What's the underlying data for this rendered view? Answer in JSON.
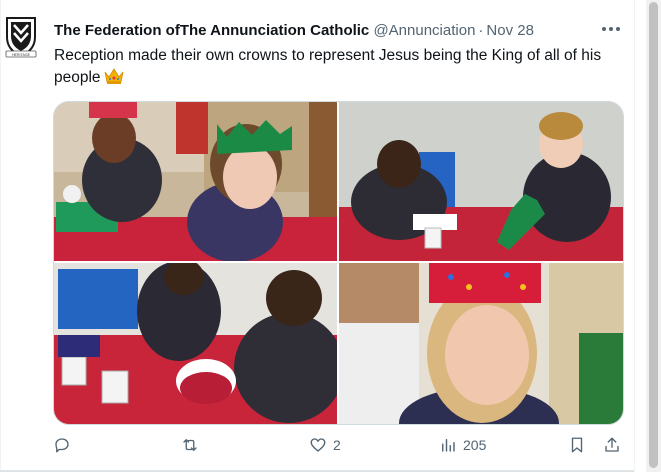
{
  "tweet": {
    "author_name": "The Federation ofThe Annunciation Catholic",
    "handle": "@Annunciation",
    "separator": "·",
    "date": "Nov 28",
    "text": "Reception made their own crowns to represent Jesus being the King of all of his people",
    "emoji": "crown-emoji",
    "avatar_text": "HERITAGE"
  },
  "media": {
    "photos": [
      {
        "description_icon": "photo-children-crowns-table"
      },
      {
        "description_icon": "photo-children-making-crowns"
      },
      {
        "description_icon": "photo-children-decorating-crown"
      },
      {
        "description_icon": "photo-girl-wearing-crown"
      }
    ]
  },
  "actions": {
    "reply_count": "",
    "retweet_count": "",
    "like_count": "2",
    "view_count": "205",
    "icons": [
      "reply-icon",
      "retweet-icon",
      "like-icon",
      "views-icon",
      "bookmark-icon",
      "share-icon"
    ]
  },
  "colors": {
    "text_primary": "#0f1419",
    "text_secondary": "#536471",
    "border": "#cfd9de",
    "crown_gold": "#f5b301"
  }
}
